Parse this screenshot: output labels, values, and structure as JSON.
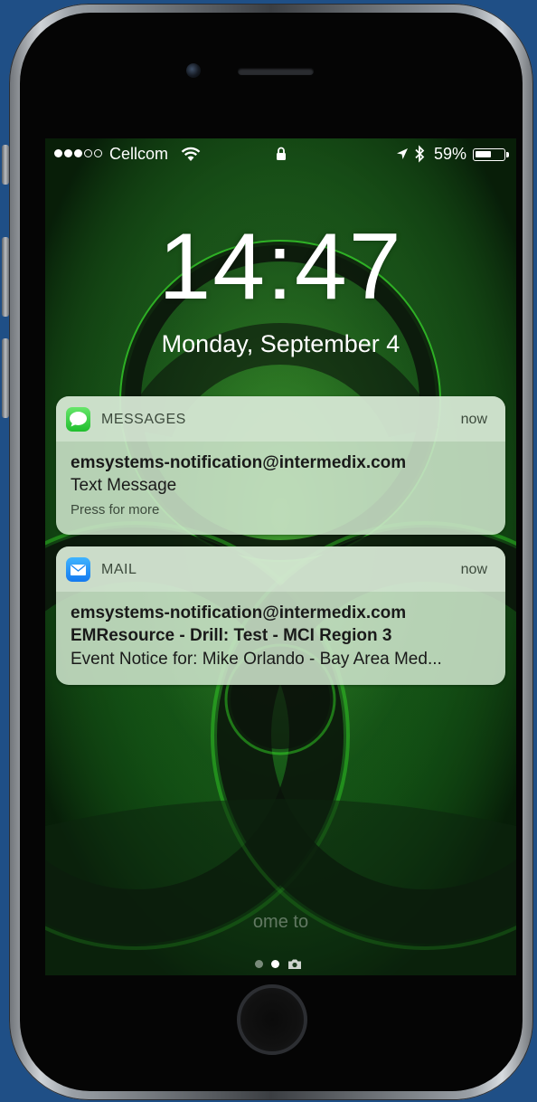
{
  "status_bar": {
    "carrier": "Cellcom",
    "signal_bars_filled": 3,
    "signal_bars_total": 5,
    "battery_percent": "59%",
    "battery_level": 0.59,
    "icons": [
      "wifi-icon",
      "lock-icon",
      "location-arrow-icon",
      "bluetooth-icon",
      "battery-icon"
    ]
  },
  "lock_screen": {
    "time": "14:47",
    "date": "Monday, September 4",
    "slide_hint": "ome to",
    "page_indicator_count": 2,
    "page_indicator_active": 1,
    "camera_icon": "camera-icon"
  },
  "notifications": [
    {
      "app": "MESSAGES",
      "icon": "messages-app-icon",
      "time": "now",
      "sender": "emsystems-notification@intermedix.com",
      "body": "Text Message",
      "hint": "Press for more"
    },
    {
      "app": "MAIL",
      "icon": "mail-app-icon",
      "time": "now",
      "sender": "emsystems-notification@intermedix.com",
      "subject": "EMResource - Drill: Test - MCI Region 3",
      "body": "Event Notice for: Mike Orlando - Bay Area Med..."
    }
  ],
  "colors": {
    "background": "#1f4f86",
    "wallpaper_green": "#2ea82a",
    "notification_bg": "#cde4cb"
  }
}
